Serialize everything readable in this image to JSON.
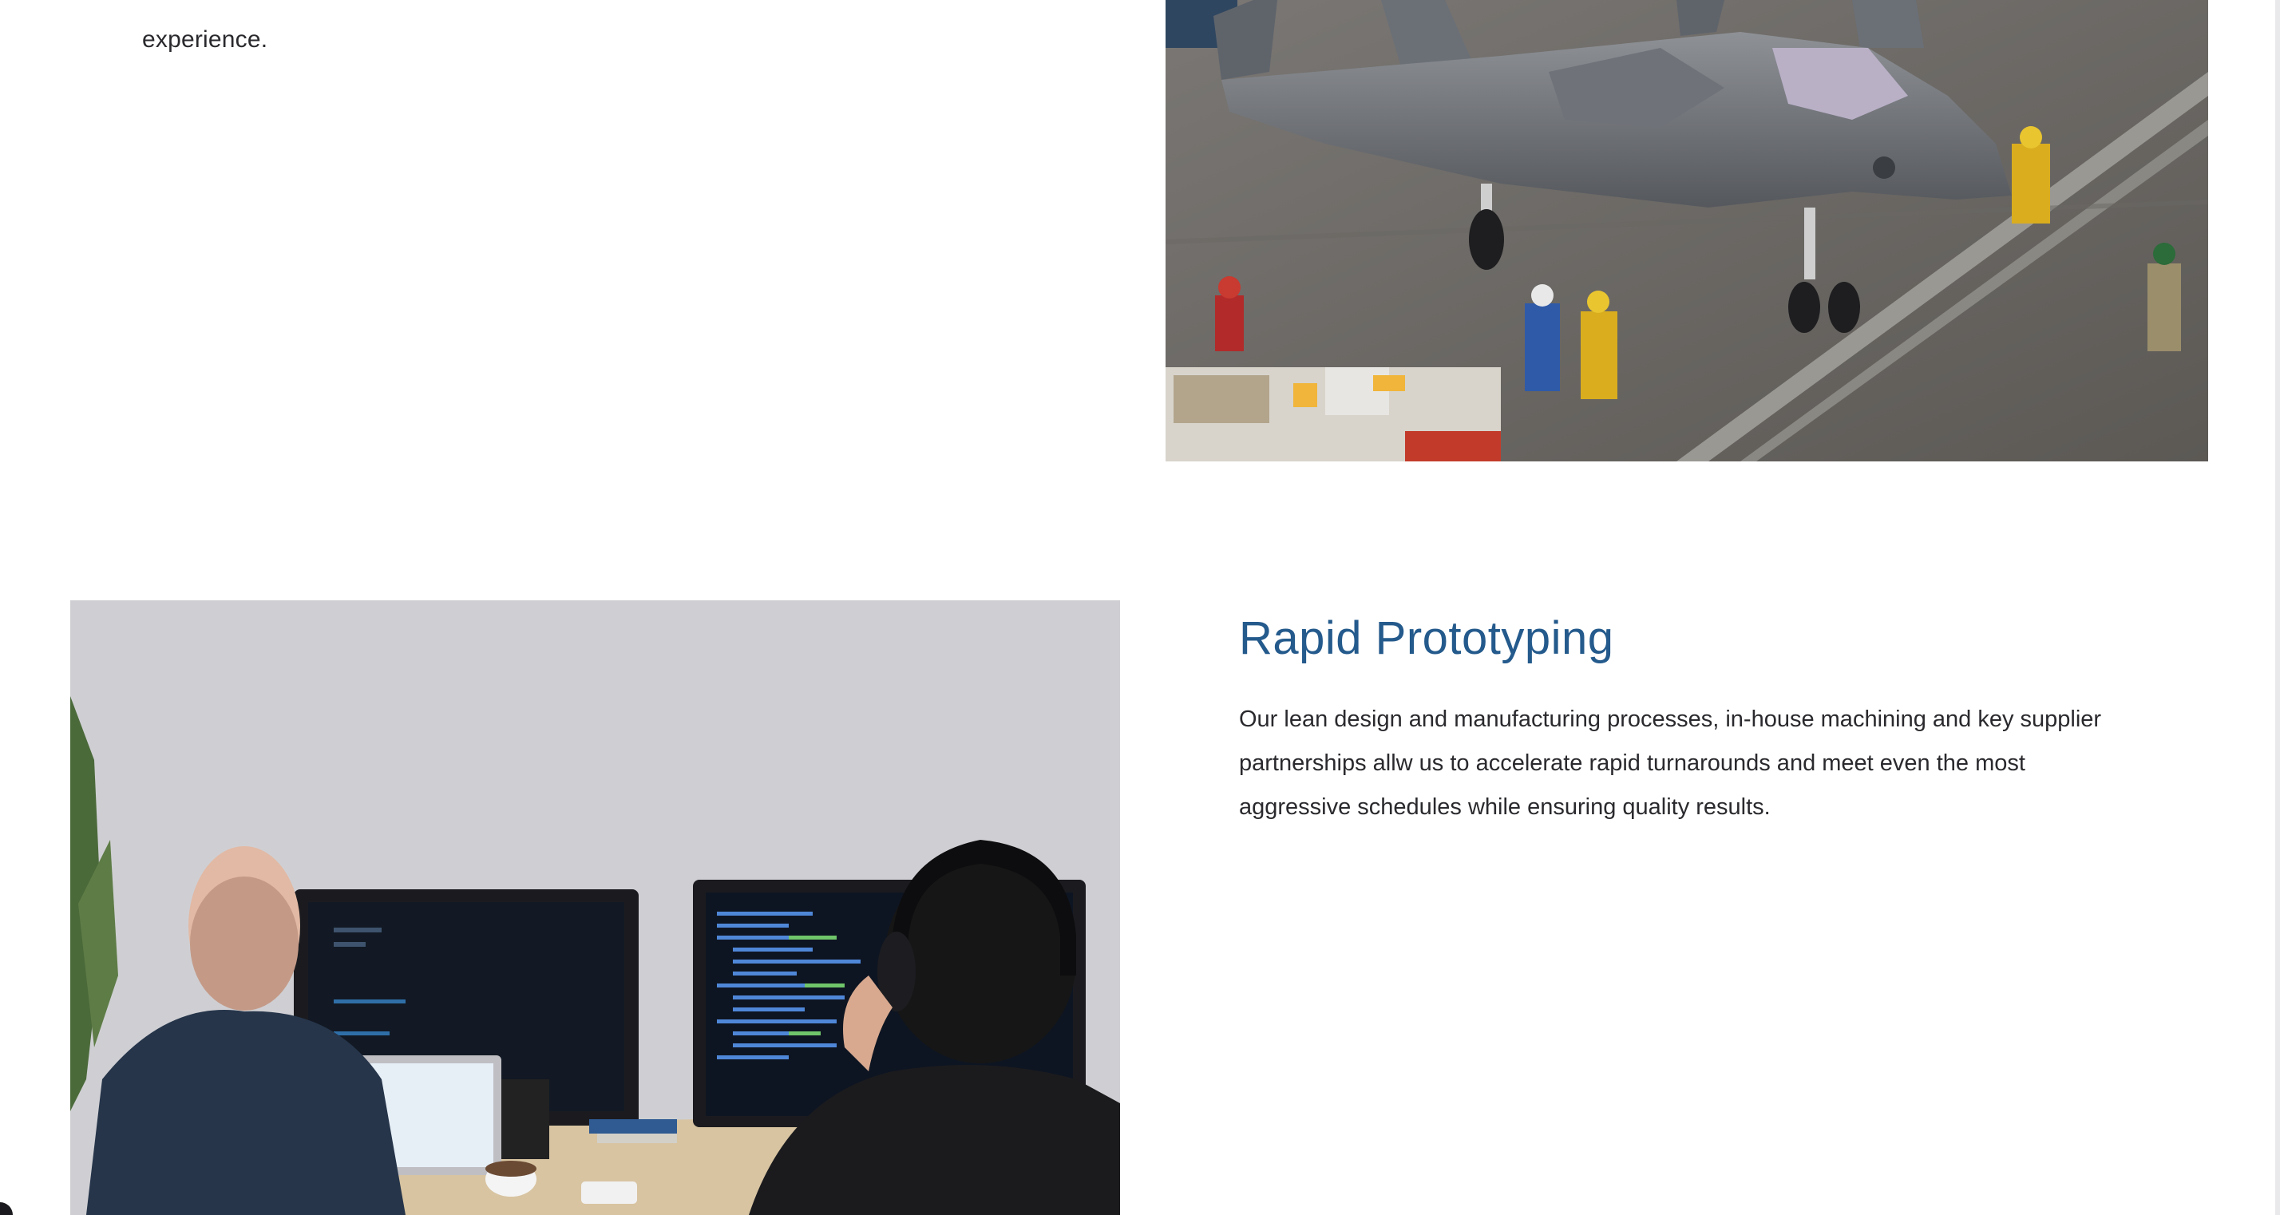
{
  "previous_section": {
    "text_tail": "experience."
  },
  "rapid_prototyping": {
    "heading": "Rapid Prototyping",
    "body": "Our lean design and manufacturing processes, in-house machining and key supplier partnerships allw us to accelerate rapid turnarounds and meet even the most aggressive schedules while ensuring quality results."
  },
  "colors": {
    "heading": "#245a8c",
    "body_text": "#2a2a2e",
    "background": "#ffffff"
  }
}
